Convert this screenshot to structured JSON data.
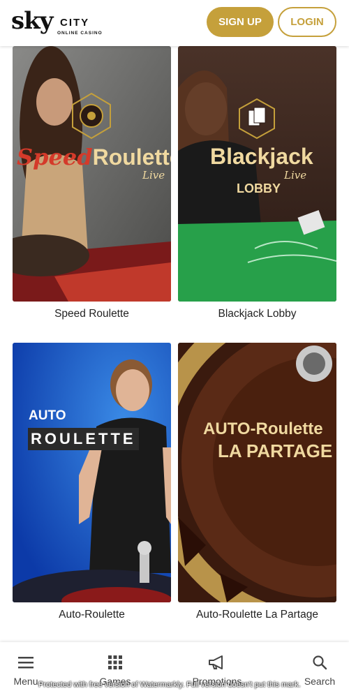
{
  "header": {
    "logo_sky": "sky",
    "logo_city": "CITY",
    "logo_sub": "ONLINE CASINO",
    "signup_label": "SIGN UP",
    "login_label": "LOGIN"
  },
  "games": [
    {
      "label": "Speed Roulette",
      "art_title_1": "Speed",
      "art_title_2": "Roulette",
      "art_sub": "Live"
    },
    {
      "label": "Blackjack Lobby",
      "art_title_1": "Blackjack",
      "art_sub": "Live",
      "art_sub2": "LOBBY"
    },
    {
      "label": "Auto-Roulette",
      "art_title_1": "AUTO",
      "art_title_2": "ROULETTE"
    },
    {
      "label": "Auto-Roulette La Partage",
      "art_title_1": "AUTO-Roulette",
      "art_title_2": "LA PARTAGE"
    }
  ],
  "bottom_nav": [
    {
      "label": "Menu",
      "icon": "menu-icon"
    },
    {
      "label": "Games",
      "icon": "grid-icon"
    },
    {
      "label": "Promotions",
      "icon": "megaphone-icon"
    },
    {
      "label": "Search",
      "icon": "search-icon"
    }
  ],
  "watermark": "Protected with free version of Watermarkly. Full version doesn't put this mark.",
  "colors": {
    "brand_gold": "#c5a03b",
    "text": "#222222"
  }
}
